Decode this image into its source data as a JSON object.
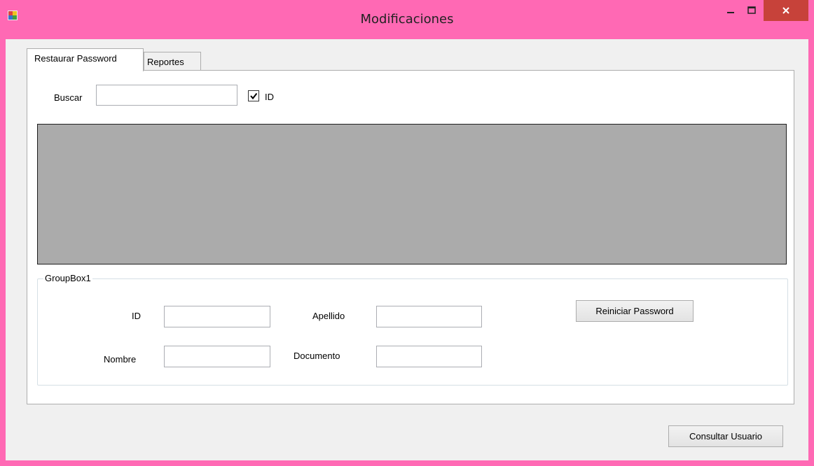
{
  "window": {
    "title": "Modificaciones",
    "title_bar_color": "#ff69b4",
    "close_button_color": "#c7423a"
  },
  "tabs": [
    {
      "label": "Restaurar Password",
      "active": true
    },
    {
      "label": "Reportes",
      "active": false
    }
  ],
  "search": {
    "label": "Buscar",
    "value": "",
    "checkbox_label": "ID",
    "checkbox_checked": true
  },
  "data_grid": {
    "background": "#ababab"
  },
  "groupbox": {
    "title": "GroupBox1",
    "fields": {
      "id_label": "ID",
      "id_value": "",
      "apellido_label": "Apellido",
      "apellido_value": "",
      "nombre_label": "Nombre",
      "nombre_value": "",
      "documento_label": "Documento",
      "documento_value": ""
    },
    "reset_button_label": "Reiniciar Password"
  },
  "footer": {
    "consultar_button_label": "Consultar Usuario"
  },
  "icons": {
    "app": "app-icon",
    "minimize": "minimize-icon",
    "maximize": "maximize-icon",
    "close": "close-icon",
    "check": "checkmark-icon"
  }
}
